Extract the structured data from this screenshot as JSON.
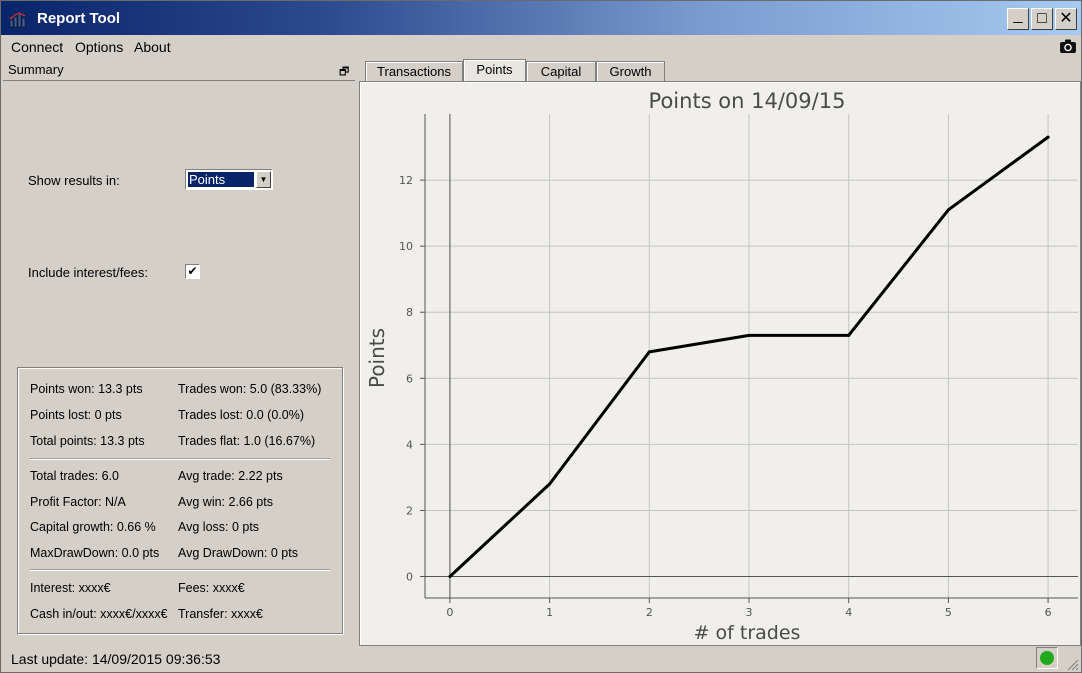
{
  "window": {
    "title": "Report Tool",
    "minimize_glyph": "_",
    "maximize_glyph": "□",
    "close_glyph": "✕"
  },
  "menu": {
    "items": [
      "Connect",
      "Options",
      "About"
    ]
  },
  "summary": {
    "title": "Summary",
    "show_results_label": "Show results in:",
    "show_results_value": "Points",
    "include_fees_label": "Include interest/fees:",
    "include_fees_checked": true,
    "stats": {
      "points_won": "Points won: 13.3 pts",
      "trades_won": "Trades won: 5.0 (83.33%)",
      "points_lost": "Points lost: 0 pts",
      "trades_lost": "Trades lost: 0.0 (0.0%)",
      "total_points": "Total points: 13.3 pts",
      "trades_flat": "Trades flat: 1.0 (16.67%)",
      "total_trades": "Total trades: 6.0",
      "avg_trade": "Avg trade: 2.22 pts",
      "profit_factor": "Profit Factor: N/A",
      "avg_win": "Avg win: 2.66 pts",
      "capital_growth": "Capital growth: 0.66 %",
      "avg_loss": "Avg loss: 0 pts",
      "max_drawdown": "MaxDrawDown: 0.0 pts",
      "avg_drawdown": "Avg DrawDown: 0 pts",
      "interest": "Interest: xxxx€",
      "fees": "Fees: xxxx€",
      "cash_inout": "Cash in/out: xxxx€/xxxx€",
      "transfer": "Transfer: xxxx€"
    }
  },
  "status": {
    "last_update": "Last update: 14/09/2015 09:36:53",
    "connection_color": "#22a81c"
  },
  "tabs": [
    {
      "label": "Transactions",
      "active": false
    },
    {
      "label": "Points",
      "active": true
    },
    {
      "label": "Capital",
      "active": false
    },
    {
      "label": "Growth",
      "active": false
    }
  ],
  "chart_data": {
    "type": "line",
    "title": "Points on 14/09/15",
    "xlabel": "# of trades",
    "ylabel": "Points",
    "x": [
      0,
      1,
      2,
      3,
      4,
      5,
      6
    ],
    "series": [
      {
        "values": [
          0,
          2.8,
          6.8,
          7.3,
          7.3,
          11.1,
          13.3
        ]
      }
    ],
    "xlim": [
      -0.25,
      6.3
    ],
    "ylim": [
      -0.65,
      14.0
    ],
    "xticks": [
      0,
      1,
      2,
      3,
      4,
      5,
      6
    ],
    "yticks": [
      0,
      2,
      4,
      6,
      8,
      10,
      12
    ],
    "grid": true,
    "line_color": "#000000"
  }
}
